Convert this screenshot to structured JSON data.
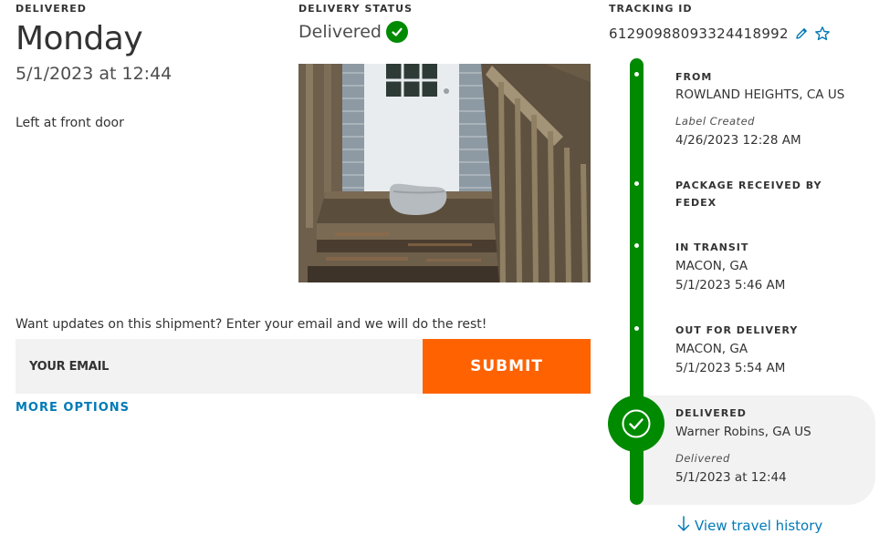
{
  "left": {
    "delivered_label": "DELIVERED",
    "day": "Monday",
    "datetime": "5/1/2023 at 12:44",
    "left_at": "Left at front door"
  },
  "status": {
    "label": "DELIVERY STATUS",
    "value": "Delivered",
    "check_icon": "check-circle-icon"
  },
  "tracking": {
    "label": "TRACKING ID",
    "id": "612909880933244189​92",
    "edit_icon": "pencil-icon",
    "favorite_icon": "star-icon"
  },
  "updates": {
    "prompt": "Want updates on this shipment? Enter your email and we will do the rest!",
    "email_placeholder": "YOUR EMAIL",
    "submit_label": "SUBMIT",
    "more_options": "MORE OPTIONS"
  },
  "timeline": {
    "events": [
      {
        "status": "FROM",
        "location": "ROWLAND HEIGHTS, CA US",
        "note": "Label Created",
        "time": "4/26/2023 12:28 AM"
      },
      {
        "status": "PACKAGE RECEIVED BY FEDEX"
      },
      {
        "status": "IN TRANSIT",
        "location": "MACON, GA",
        "time": "5/1/2023 5:46 AM"
      },
      {
        "status": "OUT FOR DELIVERY",
        "location": "MACON, GA",
        "time": "5/1/2023 5:54 AM"
      },
      {
        "status": "DELIVERED",
        "location": "Warner Robins, GA US",
        "note": "Delivered",
        "time": "5/1/2023 at 12:44"
      }
    ],
    "view_history": "View travel history"
  },
  "colors": {
    "green": "#008a00",
    "orange": "#ff6200",
    "link_blue": "#007ab7"
  }
}
